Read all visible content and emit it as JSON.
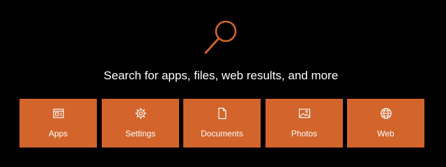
{
  "colors": {
    "background": "#000000",
    "accent": "#d2642c",
    "text": "#ffffff"
  },
  "hero": {
    "icon": "search-icon",
    "prompt": "Search for apps, files, web results, and more"
  },
  "categories": [
    {
      "label": "Apps",
      "icon": "apps-icon"
    },
    {
      "label": "Settings",
      "icon": "gear-icon"
    },
    {
      "label": "Documents",
      "icon": "document-icon"
    },
    {
      "label": "Photos",
      "icon": "photo-icon"
    },
    {
      "label": "Web",
      "icon": "globe-icon"
    }
  ]
}
